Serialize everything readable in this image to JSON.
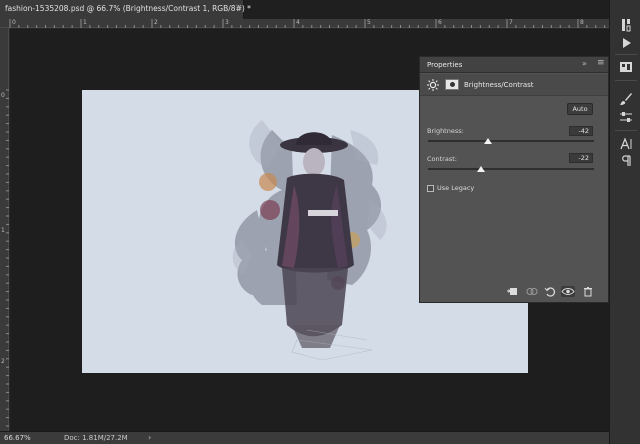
{
  "document_tab": {
    "title": "fashion-1535208.psd @ 66.7% (Brightness/Contrast 1, RGB/8#) *",
    "close_glyph": "×"
  },
  "rulers": {
    "top_labels": [
      "0",
      "1",
      "2",
      "3",
      "4",
      "5",
      "6",
      "7",
      "8",
      "9"
    ],
    "left_labels": [
      "0",
      "1",
      "2"
    ]
  },
  "status_bar": {
    "zoom": "66.67%",
    "doc_info": "Doc: 1.81M/27.2M",
    "arrow": "›"
  },
  "properties": {
    "title": "Properties",
    "collapse_glyph": "»",
    "menu_glyph": "≡",
    "adjustment_icon": "sun-icon",
    "adjustment_name": "Brightness/Contrast",
    "auto_label": "Auto",
    "brightness": {
      "label": "Brightness:",
      "value": "-42",
      "slider_fraction": 0.36
    },
    "contrast": {
      "label": "Contrast:",
      "value": "-22",
      "slider_fraction": 0.32
    },
    "use_legacy": {
      "label": "Use Legacy",
      "checked": false
    },
    "footer_buttons": [
      "clip-to-layer-icon",
      "view-previous-icon",
      "reset-icon",
      "visibility-eye-icon",
      "trash-icon"
    ]
  },
  "toolstrip_icons": [
    "history-icon",
    "play-icon",
    "libraries-icon",
    "brush-icon",
    "adjust-sliders-icon",
    "character-icon",
    "paragraph-icon"
  ],
  "colors": {
    "canvas_bg": "#d4dce8",
    "panel_bg": "#535353",
    "app_bg": "#282828"
  }
}
